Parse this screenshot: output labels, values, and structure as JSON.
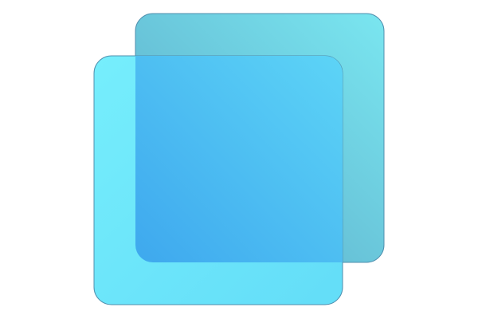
{
  "icon": {
    "name": "overlapping-squares-icon",
    "colors": {
      "back_square_light": "#7AE6F0",
      "back_square_dark": "#5AA8C6",
      "front_square_light": "#76EEFC",
      "front_square_dark": "#3FAEF0",
      "overlap_light": "#63DDF8",
      "overlap_dark": "#3EA8EE",
      "edge": "#4F8FAE",
      "background": "#FFFFFF"
    }
  }
}
